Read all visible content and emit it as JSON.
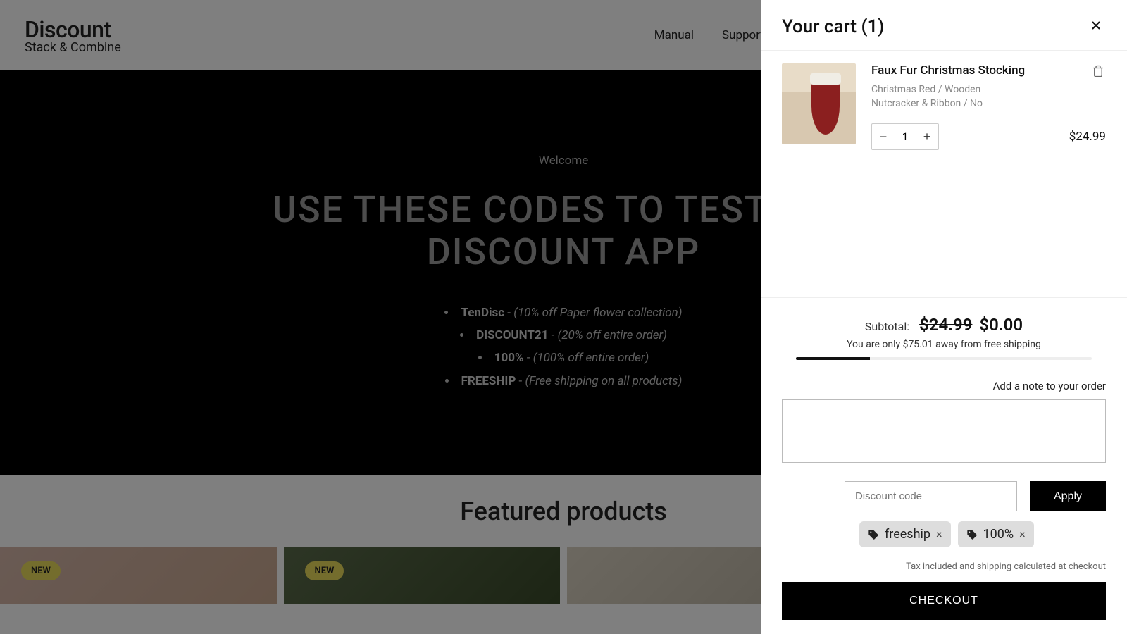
{
  "header": {
    "logo_main": "Discount",
    "logo_sub": "Stack & Combine",
    "nav": {
      "manual": "Manual",
      "support": "Support"
    }
  },
  "hero": {
    "welcome": "Welcome",
    "title_line1": "USE THESE CODES TO TEST OUR",
    "title_line2": "DISCOUNT APP",
    "codes": [
      {
        "code": "TenDisc",
        "sep": " - ",
        "desc": "(10% off Paper flower collection)"
      },
      {
        "code": "DISCOUNT21",
        "sep": " - ",
        "desc": "(20% off entire order)"
      },
      {
        "code": "100%",
        "sep": " - ",
        "desc": "(100% off entire order)"
      },
      {
        "code": "FREESHIP",
        "sep": " - ",
        "desc": "(Free shipping on all products)"
      }
    ]
  },
  "featured": {
    "title": "Featured products"
  },
  "badges": {
    "new1": "NEW",
    "new2": "NEW"
  },
  "cart": {
    "title": "Your cart (1)",
    "item": {
      "title": "Faux Fur Christmas Stocking",
      "variant_line1": "Christmas Red / Wooden",
      "variant_line2": "Nutcracker & Ribbon / No",
      "qty": "1",
      "price": "$24.99"
    },
    "subtotal_label": "Subtotal:",
    "subtotal_old": "$24.99",
    "subtotal_new": "$0.00",
    "freeship_msg": "You are only $75.01 away from free shipping",
    "progress_percent": 25,
    "note_label": "Add a note to your order",
    "note_value": "",
    "disc_placeholder": "Discount code",
    "apply_label": "Apply",
    "tags": [
      {
        "label": "freeship"
      },
      {
        "label": "100%"
      }
    ],
    "tax_note": "Tax included and shipping calculated at checkout",
    "checkout_label": "CHECKOUT"
  }
}
